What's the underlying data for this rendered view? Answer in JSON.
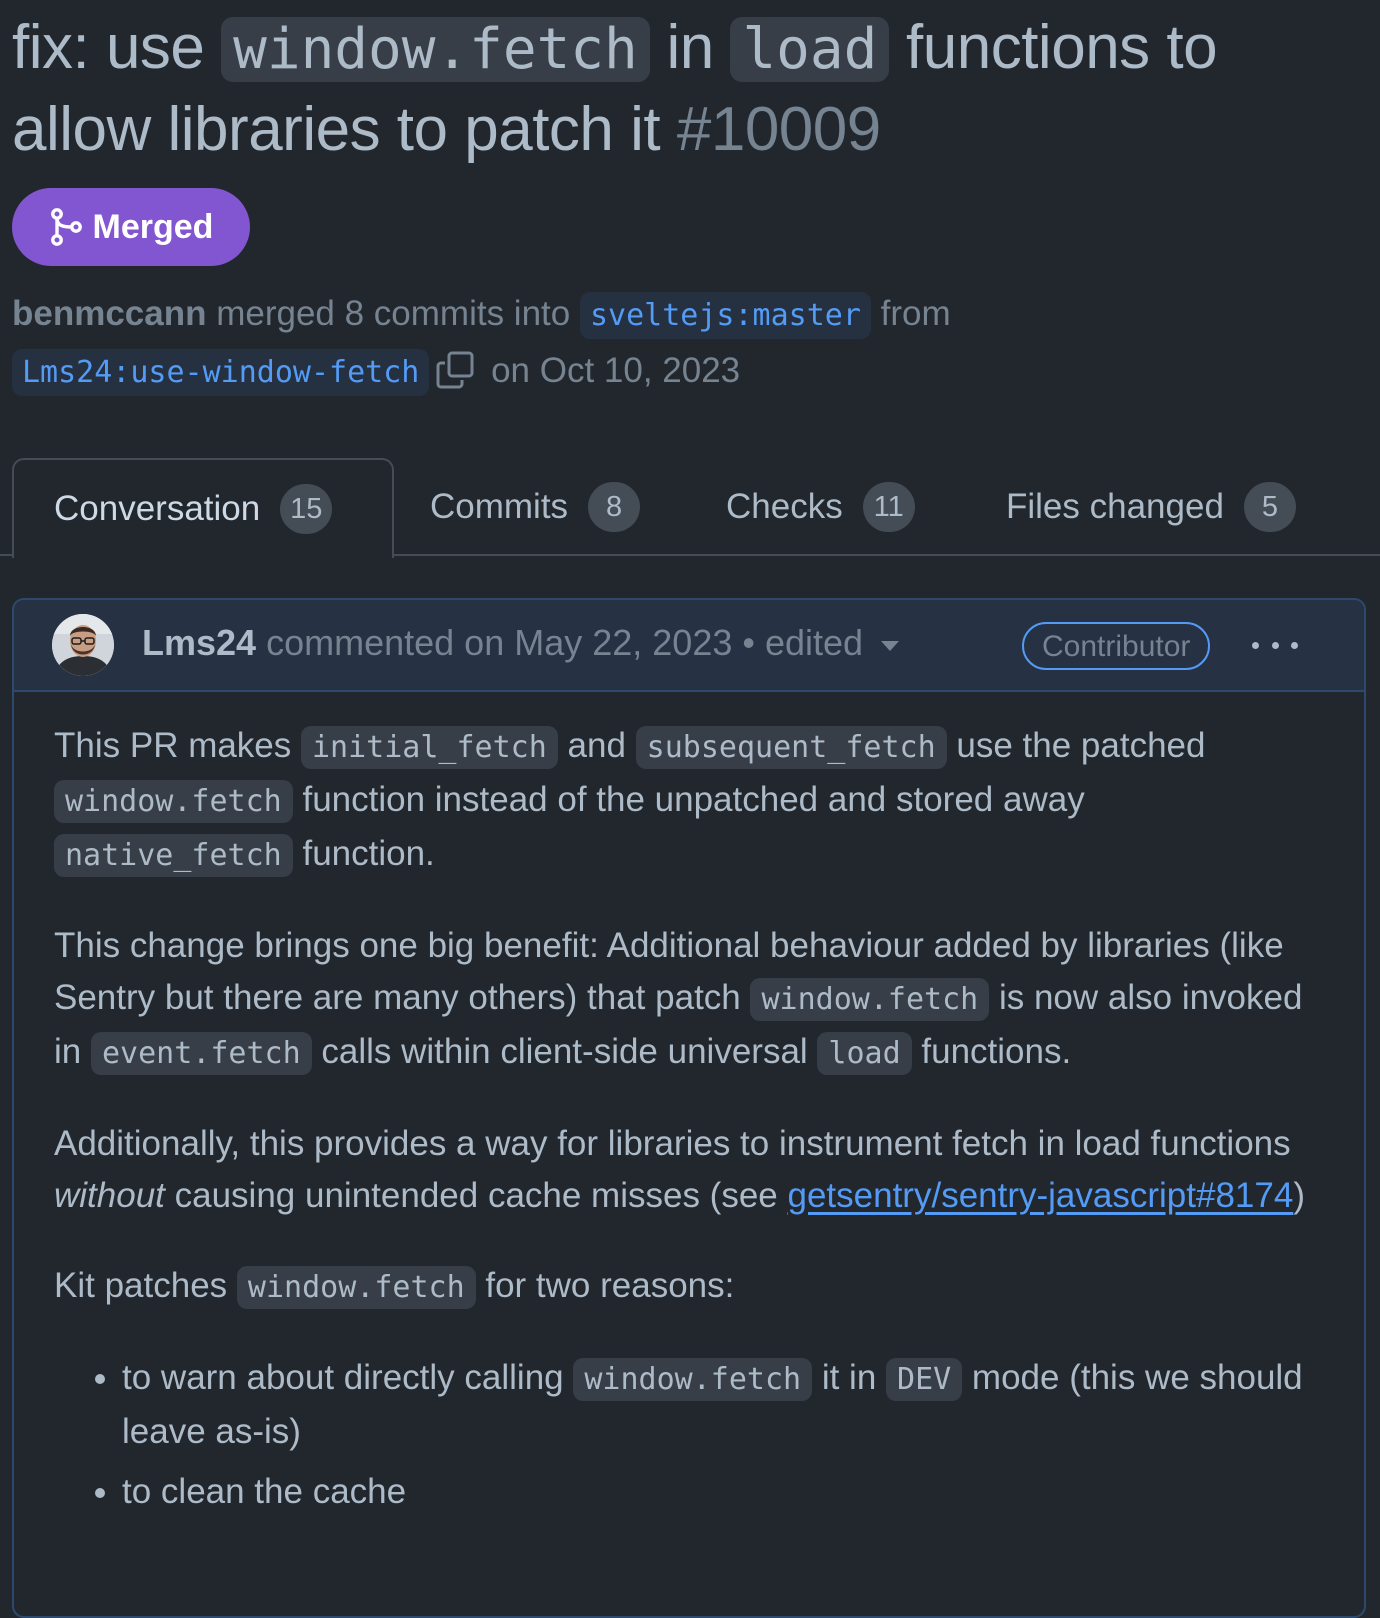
{
  "pr": {
    "title_part1": "fix: use ",
    "title_code1": "window.fetch",
    "title_part2": " in ",
    "title_code2": "load",
    "title_part3": " functions to allow libraries to patch it ",
    "number": "#10009"
  },
  "state": {
    "label": "Merged",
    "icon": "git-merge-icon",
    "color": "#8256d0"
  },
  "meta": {
    "author": "benmccann",
    "text1": " merged 8 commits into ",
    "base_branch": "sveltejs:master",
    "text2": " from ",
    "head_branch": "Lms24:use-window-fetch",
    "copy_icon": "copy-icon",
    "date": " on Oct 10, 2023"
  },
  "tabs": [
    {
      "label": "Conversation",
      "count": "15"
    },
    {
      "label": "Commits",
      "count": "8"
    },
    {
      "label": "Checks",
      "count": "11"
    },
    {
      "label": "Files changed",
      "count": "5"
    }
  ],
  "comment": {
    "login": "Lms24",
    "action": " commented on May 22, 2023",
    "separator": " • ",
    "edited": "edited",
    "role": "Contributor",
    "more_icon": "kebab-horizontal-icon",
    "p1": {
      "t1": "This PR makes ",
      "c1": "initial_fetch",
      "t2": " and ",
      "c2": "subsequent_fetch",
      "t3": " use the patched ",
      "c3": "window.fetch",
      "t4": " function instead of the unpatched and stored away ",
      "c4": "native_fetch",
      "t5": " function."
    },
    "p2": {
      "t1": "This change brings one big benefit: Additional behaviour added by libraries (like Sentry but there are many others) that patch ",
      "c1": "window.fetch",
      "t2": " is now also invoked in ",
      "c2": "event.fetch",
      "t3": " calls within client-side universal ",
      "c3": "load",
      "t4": " functions."
    },
    "p3": {
      "t1": "Additionally, this provides a way for libraries to instrument fetch in load functions ",
      "em": "without",
      "t2": " causing unintended cache misses (see ",
      "link": "getsentry/sentry-javascript#8174",
      "t3": ")"
    },
    "p4": {
      "t1": "Kit patches ",
      "c1": "window.fetch",
      "t2": " for two reasons:"
    },
    "list": {
      "item1_t1": "to warn about directly calling ",
      "item1_c1": "window.fetch",
      "item1_t2": " it in ",
      "item1_c2": "DEV",
      "item1_t3": " mode (this we should leave as-is)",
      "item2": "to clean the cache"
    }
  }
}
